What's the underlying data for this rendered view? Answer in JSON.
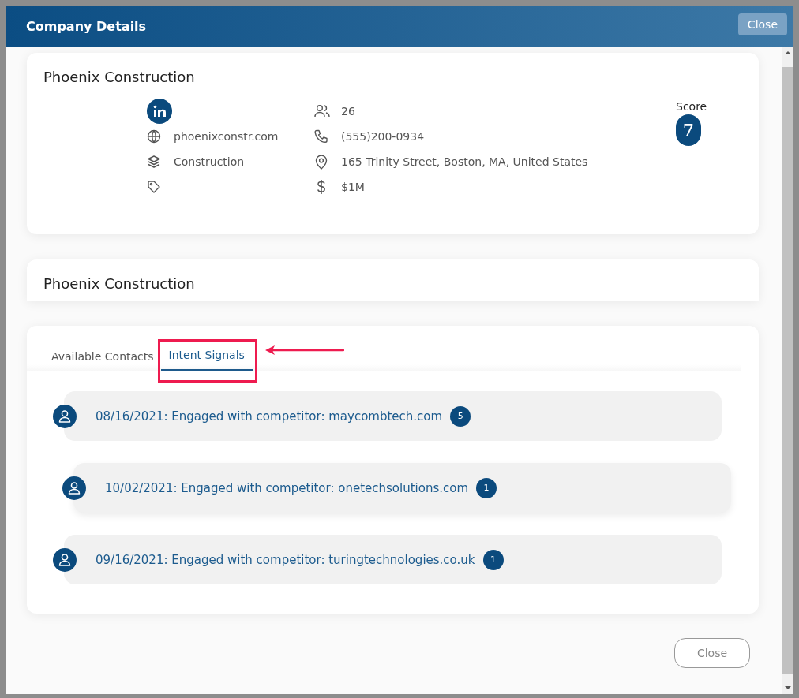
{
  "dialog": {
    "title": "Company Details",
    "close_button": "Close"
  },
  "company_card": {
    "name": "Phoenix Construction",
    "details_left": [
      {
        "kind": "linkedin"
      },
      {
        "kind": "website",
        "value": "phoenixconstr.com"
      },
      {
        "kind": "industry",
        "value": "Construction"
      },
      {
        "kind": "tags"
      }
    ],
    "details_right": [
      {
        "kind": "employees",
        "value": "26"
      },
      {
        "kind": "phone",
        "value": "(555)200-0934"
      },
      {
        "kind": "address",
        "value": "165 Trinity Street, Boston, MA, United States"
      },
      {
        "kind": "revenue",
        "value": "$1M"
      }
    ],
    "score": {
      "label": "Score",
      "value": "7"
    }
  },
  "second_card": {
    "name": "Phoenix Construction"
  },
  "tabs": [
    {
      "label": "Available Contacts",
      "selected": false,
      "annotated": false
    },
    {
      "label": "Intent Signals",
      "selected": true,
      "annotated": true
    }
  ],
  "signals": [
    {
      "text": "08/16/2021: Engaged with competitor: maycombtech.com",
      "count": "5"
    },
    {
      "text": "10/02/2021: Engaged with competitor: onetechsolutions.com",
      "count": "1"
    },
    {
      "text": "09/16/2021: Engaged with competitor: turingtechnologies.co.uk",
      "count": "1"
    }
  ],
  "footer": {
    "close_button": "Close"
  }
}
